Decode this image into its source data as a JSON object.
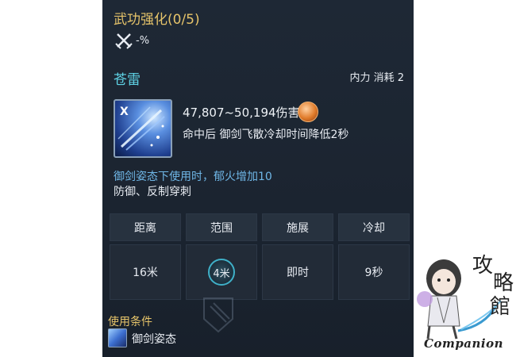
{
  "enhance": {
    "title": "武功强化(0/5)",
    "value": "-%",
    "icon": "crossed-swords-icon"
  },
  "skill": {
    "name": "苍雷",
    "cost": "内力 消耗 2",
    "hotkey": "X",
    "damage": "47,807~50,194伤害",
    "damage_icon": "fist-icon",
    "effect": "命中后 御剑飞散冷却时间降低2秒"
  },
  "stance": {
    "note": "御剑姿态下使用时，郁火增加10",
    "note2": "防御、反制穿刺"
  },
  "stats": {
    "headers": [
      "距离",
      "范围",
      "施展",
      "冷却"
    ],
    "values": [
      "16米",
      "4米",
      "即时",
      "9秒"
    ]
  },
  "condition": {
    "title": "使用条件",
    "text": "御剑姿态",
    "icon": "sword-stance-icon"
  },
  "logo": {
    "text": "Companion"
  },
  "colors": {
    "panel_bg": "#1d2633",
    "gold": "#e6c46a",
    "cyan": "#5fd3e6",
    "blue_note": "#6fb6e6"
  }
}
